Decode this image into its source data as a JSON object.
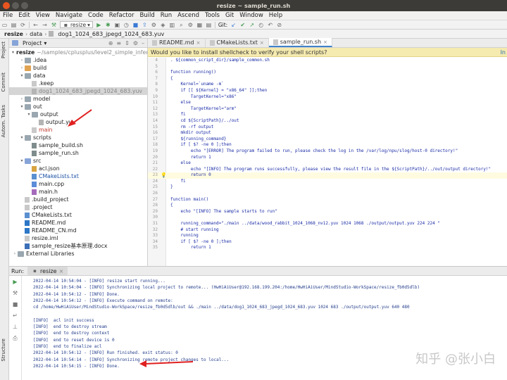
{
  "window": {
    "title": "resize ~ sample_run.sh"
  },
  "menu": [
    "File",
    "Edit",
    "View",
    "Navigate",
    "Code",
    "Refactor",
    "Build",
    "Run",
    "Ascend",
    "Tools",
    "Git",
    "Window",
    "Help"
  ],
  "toolbar": {
    "config": "resize",
    "git_label": "Git:"
  },
  "breadcrumb": [
    "resize",
    "data",
    "dog1_1024_683_jpegd_1024_683.yuv"
  ],
  "project_panel": {
    "title": "Project",
    "tree": [
      {
        "indent": 0,
        "arrow": "▾",
        "icon": "module",
        "label": "resize",
        "hint": "~/samples/cplusplus/level2_simple_inference",
        "bold": true
      },
      {
        "indent": 1,
        "arrow": "›",
        "icon": "folder",
        "label": ".idea"
      },
      {
        "indent": 1,
        "arrow": "›",
        "icon": "folder orange",
        "label": "build"
      },
      {
        "indent": 1,
        "arrow": "▾",
        "icon": "folder",
        "label": "data"
      },
      {
        "indent": 2,
        "arrow": "",
        "icon": "file",
        "label": ".keep"
      },
      {
        "indent": 2,
        "arrow": "",
        "icon": "file yuv",
        "label": "dog1_1024_683_jpegd_1024_683.yuv",
        "selected": true,
        "style": "muted"
      },
      {
        "indent": 1,
        "arrow": "›",
        "icon": "folder",
        "label": "model"
      },
      {
        "indent": 1,
        "arrow": "▾",
        "icon": "folder",
        "label": "out"
      },
      {
        "indent": 2,
        "arrow": "▾",
        "icon": "folder",
        "label": "output"
      },
      {
        "indent": 3,
        "arrow": "",
        "icon": "file yuv",
        "label": "output.yuv"
      },
      {
        "indent": 2,
        "arrow": "",
        "icon": "file",
        "label": "main",
        "style": "red"
      },
      {
        "indent": 1,
        "arrow": "▾",
        "icon": "folder",
        "label": "scripts"
      },
      {
        "indent": 2,
        "arrow": "",
        "icon": "file sh",
        "label": "sample_build.sh"
      },
      {
        "indent": 2,
        "arrow": "",
        "icon": "file sh",
        "label": "sample_run.sh"
      },
      {
        "indent": 1,
        "arrow": "▾",
        "icon": "folder blue",
        "label": "src"
      },
      {
        "indent": 2,
        "arrow": "",
        "icon": "file json",
        "label": "acl.json"
      },
      {
        "indent": 2,
        "arrow": "",
        "icon": "file txt",
        "label": "CMakeLists.txt",
        "style": "blue"
      },
      {
        "indent": 2,
        "arrow": "",
        "icon": "file cpp",
        "label": "main.cpp"
      },
      {
        "indent": 2,
        "arrow": "",
        "icon": "file h",
        "label": "main.h"
      },
      {
        "indent": 1,
        "arrow": "",
        "icon": "file",
        "label": ".build_project"
      },
      {
        "indent": 1,
        "arrow": "",
        "icon": "file",
        "label": ".project"
      },
      {
        "indent": 1,
        "arrow": "",
        "icon": "file txt",
        "label": "CMakeLists.txt"
      },
      {
        "indent": 1,
        "arrow": "",
        "icon": "file md",
        "label": "README.md"
      },
      {
        "indent": 1,
        "arrow": "",
        "icon": "file md",
        "label": "README_CN.md"
      },
      {
        "indent": 1,
        "arrow": "",
        "icon": "file",
        "label": "resize.iml"
      },
      {
        "indent": 1,
        "arrow": "",
        "icon": "file docx",
        "label": "sample_resize基本原理.docx"
      },
      {
        "indent": 0,
        "arrow": "›",
        "icon": "folder",
        "label": "External Libraries"
      }
    ]
  },
  "editor": {
    "tabs": [
      {
        "label": "README.md",
        "active": false
      },
      {
        "label": "CMakeLists.txt",
        "active": false
      },
      {
        "label": "sample_run.sh",
        "active": true
      }
    ],
    "notice": "Would you like to install shellcheck to verify your shell scripts?",
    "notice_link": "In",
    "lines": [
      {
        "n": "4",
        "text": ". ${common_script_dir}/sample_common.sh"
      },
      {
        "n": "5",
        "text": ""
      },
      {
        "n": "6",
        "text": "function running()"
      },
      {
        "n": "7",
        "text": "{"
      },
      {
        "n": "8",
        "text": "    Kernel=`uname -m`"
      },
      {
        "n": "9",
        "text": "    if [[ ${Kernel} = \"x86_64\" ]];then"
      },
      {
        "n": "10",
        "text": "        TargetKernel=\"x86\""
      },
      {
        "n": "11",
        "text": "    else"
      },
      {
        "n": "12",
        "text": "        TargetKernel=\"arm\""
      },
      {
        "n": "13",
        "text": "    fi"
      },
      {
        "n": "14",
        "text": "    cd ${ScriptPath}/../out"
      },
      {
        "n": "15",
        "text": "    rm -rf output"
      },
      {
        "n": "16",
        "text": "    mkdir output"
      },
      {
        "n": "17",
        "text": "    ${running_command}"
      },
      {
        "n": "18",
        "text": "    if [ $? -ne 0 ];then"
      },
      {
        "n": "19",
        "text": "        echo \"[ERROR] The program failed to run, please check the log in the /var/log/npu/slog/host-0 directory!\""
      },
      {
        "n": "20",
        "text": "        return 1"
      },
      {
        "n": "21",
        "text": "    else"
      },
      {
        "n": "22",
        "text": "        echo \"[INFO] The program runs successfully, please view the result file in the ${ScriptPath}/../out/output directory!\""
      },
      {
        "n": "23",
        "text": "        return 0",
        "highlight": true
      },
      {
        "n": "24",
        "text": "    fi"
      },
      {
        "n": "25",
        "text": "}"
      },
      {
        "n": "26",
        "text": ""
      },
      {
        "n": "27",
        "text": "function main()"
      },
      {
        "n": "28",
        "text": "{"
      },
      {
        "n": "29",
        "text": "    echo \"[INFO] The sample starts to run\""
      },
      {
        "n": "30",
        "text": ""
      },
      {
        "n": "31",
        "text": "    running_command=\"./main ../data/wood_rabbit_1024_1068_nv12.yuv 1024 1068 ./output/output.yuv 224 224 \""
      },
      {
        "n": "32",
        "text": "    # start running"
      },
      {
        "n": "33",
        "text": "    running"
      },
      {
        "n": "34",
        "text": "    if [ $? -ne 0 ];then"
      },
      {
        "n": "35",
        "text": "        return 1"
      }
    ]
  },
  "run_panel": {
    "label": "Run:",
    "tab": "resize",
    "console": [
      "2022-04-14 10:54:04 - [INFO] resize start running...",
      "2022-04-14 10:54:04 - [INFO] Synchronizing local project to remote... (HwHiAiUser@192.168.199.204:/home/HwHiAiUser/MindStudio-WorkSpace/resize_fb0d5dlb)",
      "2022-04-14 10:54:12 - [INFO] Done.",
      "2022-04-14 10:54:12 - [INFO] Execute command on remote:",
      "cd /home/HwHiAiUser/MindStudio-WorkSpace/resize_fb0d5dlb/out && ./main ../data/dog1_1024_683_jpegd_1024_683.yuv 1024 683 ./output/output.yuv 640 480",
      "",
      "[INFO]  acl init success",
      "[INFO]  end to destroy stream",
      "[INFO]  end to destroy context",
      "[INFO]  end to reset device is 0",
      "[INFO]  end to finalize acl",
      "2022-04-14 10:54:12 - [INFO] Run finished. exit status: 0",
      "2022-04-14 10:54:14 - [INFO] Synchronizing remote project changes to local...",
      "2022-04-14 10:54:15 - [INFO] Done."
    ]
  },
  "side_stripe": [
    "Project",
    "Commit",
    "Autom. Tasks",
    "Structure"
  ],
  "watermark": "知乎 @张小白",
  "colors": {
    "accent": "#4083c9",
    "annotation_arrow": "#e02020",
    "notice_bg": "#f5eaaf"
  }
}
